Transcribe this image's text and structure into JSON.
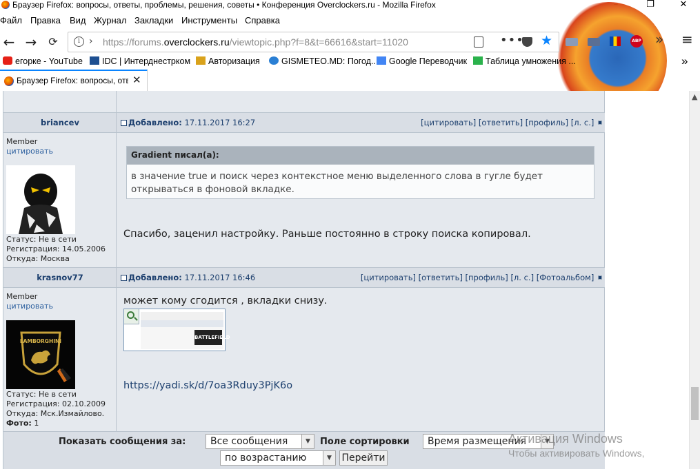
{
  "window": {
    "title": "Браузер Firefox: вопросы, ответы, проблемы, решения, советы • Конференция Overclockers.ru - Mozilla Firefox",
    "minimize": "–",
    "maximize": "❐",
    "close": "✕"
  },
  "menu": [
    "Файл",
    "Правка",
    "Вид",
    "Журнал",
    "Закладки",
    "Инструменты",
    "Справка"
  ],
  "nav": {
    "back": "←",
    "forward": "→",
    "url_prefix": "https://forums.",
    "url_domain": "overclockers.ru",
    "url_rest": "/viewtopic.php?f=8&t=66616&start=11020",
    "dots": "•••",
    "star": "★",
    "overflow": "»",
    "hamburger": "≡",
    "abp": "ABP"
  },
  "bookmarks": [
    {
      "label": "егорке - YouTube",
      "icon": "youtube-icon",
      "color": "#e62117"
    },
    {
      "label": "IDC | Интерднестрком",
      "icon": "idc-icon",
      "color": "#1d4f91"
    },
    {
      "label": "Авторизация",
      "icon": "auth-icon",
      "color": "#d9a21b"
    },
    {
      "label": "GISMETEO.MD: Погод...",
      "icon": "gismeteo-icon",
      "color": "#2a7fd4"
    },
    {
      "label": "Google Переводчик",
      "icon": "google-translate-icon",
      "color": "#4285f4"
    },
    {
      "label": "Таблица умножения ...",
      "icon": "table-icon",
      "color": "#2bb24c"
    }
  ],
  "bookmarks_more": "»",
  "tab": {
    "label": "Браузер Firefox: вопросы, отве",
    "close": "✕"
  },
  "posts": [
    {
      "author": "briancev",
      "added_label": "Добавлено:",
      "date": "17.11.2017 16:27",
      "actions": [
        "[цитировать]",
        "[ответить]",
        "[профиль]",
        "[л. с.]"
      ],
      "rank": "Member",
      "cite": "цитировать",
      "status": "Статус: Не в сети",
      "registered": "Регистрация: 14.05.2006",
      "from": "Откуда: Москва",
      "quote_author": "Gradient писал(а):",
      "quote_line1": "в значение true и поиск через контекстное меню выделенного слова в гугле будет",
      "quote_line2": "открываться в фоновой вкладке.",
      "text": "Спасибо, заценил настройку. Раньше постоянно в строку поиска копировал."
    },
    {
      "author": "krasnov77",
      "added_label": "Добавлено:",
      "date": "17.11.2017 16:46",
      "actions": [
        "[цитировать]",
        "[ответить]",
        "[профиль]",
        "[л. с.]",
        "[Фотоальбом]"
      ],
      "rank": "Member",
      "cite": "цитировать",
      "status": "Статус: Не в сети",
      "registered": "Регистрация: 02.10.2009",
      "from": "Откуда: Мск.Измайлово.",
      "photo_label": "Фото:",
      "photo_count": "1",
      "avatar_text": "LAMBORGHINI",
      "thumb_text": "BATTLEFIELD",
      "text": "может кому сгодится , вкладки снизу.",
      "link": "https://yadi.sk/d/7oa3Rduy3PjK6o"
    }
  ],
  "sort": {
    "show_label": "Показать сообщения за:",
    "show_value": "Все сообщения",
    "order_label": "Поле сортировки",
    "order_value": "Время размещения",
    "direction_value": "по возрастанию",
    "go": "Перейти"
  },
  "watermark": {
    "line1": "Активация Windows",
    "line2": "Чтобы активировать Windows,"
  },
  "colors": {
    "accent": "#0a84ff",
    "forum_bg": "#e5e9ee",
    "header_bg": "#d9dee5",
    "link": "#1c3f6e"
  }
}
